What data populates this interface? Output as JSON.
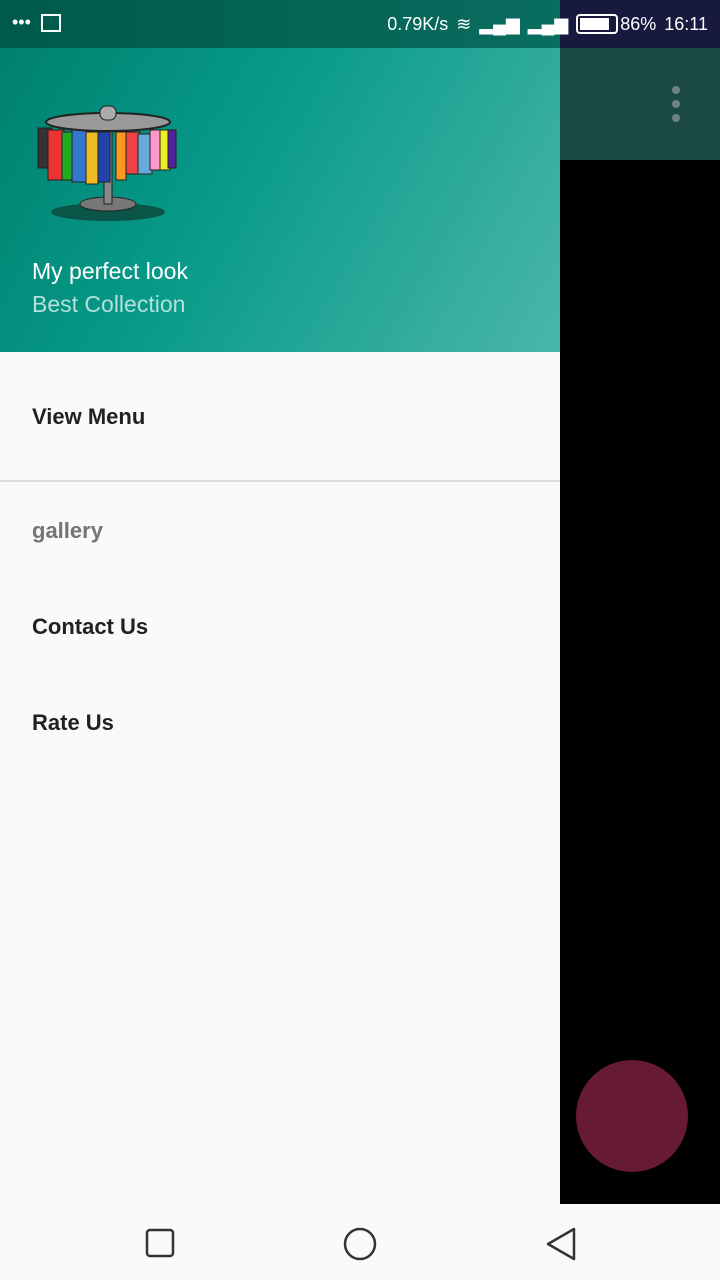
{
  "status": {
    "net_speed": "0.79K/s",
    "battery": "86%",
    "time": "16:11"
  },
  "drawer": {
    "title": "My perfect look",
    "subtitle": "Best Collection",
    "items": [
      {
        "label": "View Menu"
      },
      {
        "label": "gallery"
      },
      {
        "label": "Contact Us"
      },
      {
        "label": "Rate Us"
      }
    ]
  },
  "colors": {
    "header": "#079a89",
    "fab": "#661b33"
  }
}
